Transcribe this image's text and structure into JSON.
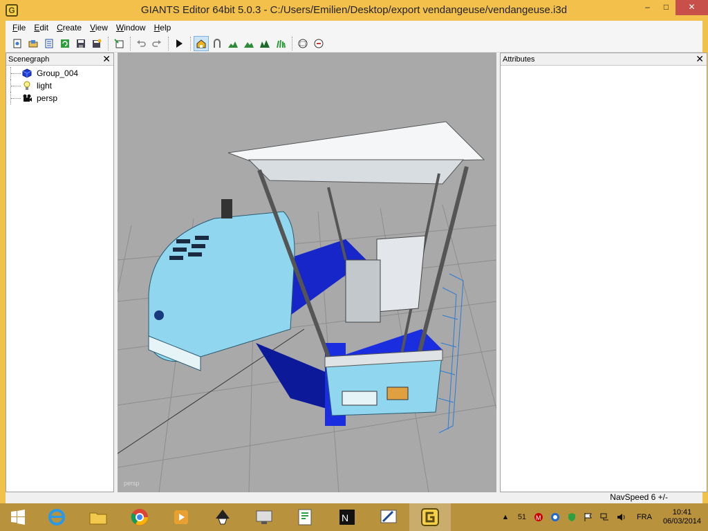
{
  "window": {
    "title": "GIANTS Editor 64bit 5.0.3 - C:/Users/Emilien/Desktop/export vendangeuse/vendangeuse.i3d",
    "app_icon_letter": "G",
    "minimize": "–",
    "maximize": "□",
    "close": "✕"
  },
  "menu": [
    {
      "label": "File",
      "u": "F",
      "rest": "ile"
    },
    {
      "label": "Edit",
      "u": "E",
      "rest": "dit"
    },
    {
      "label": "Create",
      "u": "C",
      "rest": "reate"
    },
    {
      "label": "View",
      "u": "V",
      "rest": "iew"
    },
    {
      "label": "Window",
      "u": "W",
      "rest": "indow"
    },
    {
      "label": "Help",
      "u": "H",
      "rest": "elp"
    }
  ],
  "toolbar_icons": [
    "new-file-icon",
    "open-file-icon",
    "properties-icon",
    "refresh-icon",
    "save-icon",
    "save-as-icon",
    "import-icon",
    "undo-icon",
    "redo-icon",
    "play-icon",
    "select-icon",
    "move-icon",
    "terrain-icon",
    "paint-terrain-icon",
    "foliage-icon",
    "texture-icon",
    "material-icon"
  ],
  "scenegraph": {
    "title": "Scenegraph",
    "close": "✕",
    "items": [
      {
        "label": "Group_004",
        "icon": "group-cube-icon"
      },
      {
        "label": "light",
        "icon": "light-bulb-icon"
      },
      {
        "label": "persp",
        "icon": "camera-icon"
      }
    ]
  },
  "viewport": {
    "camera_label": "persp"
  },
  "attributes": {
    "title": "Attributes",
    "close": "✕"
  },
  "status": {
    "navspeed": "NavSpeed 6 +/-"
  },
  "taskbar": {
    "apps": [
      "internet-explorer-icon",
      "file-explorer-icon",
      "chrome-icon",
      "media-player-icon",
      "inkscape-icon",
      "remote-desktop-icon",
      "notepad-plus-icon",
      "notepad-m-icon",
      "paint-icon",
      "giants-editor-icon"
    ],
    "tray_count": "51",
    "language": "FRA",
    "time": "10:41",
    "date": "06/03/2014"
  },
  "colors": {
    "accent": "#f3c04b",
    "taskbar": "#b8923c",
    "viewport": "#a9a9a9",
    "close_button": "#c7504a"
  }
}
